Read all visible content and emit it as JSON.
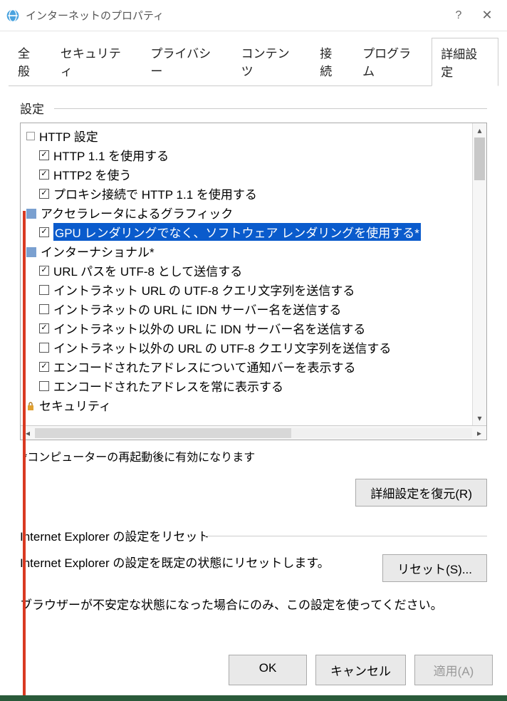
{
  "title": "インターネットのプロパティ",
  "tabs": [
    "全般",
    "セキュリティ",
    "プライバシー",
    "コンテンツ",
    "接続",
    "プログラム",
    "詳細設定"
  ],
  "activeTab": 6,
  "settings_label": "設定",
  "tree": [
    {
      "type": "cat",
      "icon": "doc",
      "label": "HTTP 設定"
    },
    {
      "type": "item",
      "checked": true,
      "label": "HTTP 1.1 を使用する"
    },
    {
      "type": "item",
      "checked": true,
      "label": "HTTP2 を使う"
    },
    {
      "type": "item",
      "checked": true,
      "label": "プロキシ接続で HTTP 1.1 を使用する"
    },
    {
      "type": "cat",
      "icon": "accel",
      "label": "アクセラレータによるグラフィック"
    },
    {
      "type": "item",
      "checked": true,
      "selected": true,
      "label": "GPU レンダリングでなく、ソフトウェア レンダリングを使用する*"
    },
    {
      "type": "cat",
      "icon": "intl",
      "label": "インターナショナル*"
    },
    {
      "type": "item",
      "checked": true,
      "label": "URL パスを UTF-8 として送信する"
    },
    {
      "type": "item",
      "checked": false,
      "label": "イントラネット URL の UTF-8 クエリ文字列を送信する"
    },
    {
      "type": "item",
      "checked": false,
      "label": "イントラネットの URL に IDN サーバー名を送信する"
    },
    {
      "type": "item",
      "checked": true,
      "label": "イントラネット以外の URL に IDN サーバー名を送信する"
    },
    {
      "type": "item",
      "checked": false,
      "label": "イントラネット以外の URL の UTF-8 クエリ文字列を送信する"
    },
    {
      "type": "item",
      "checked": true,
      "label": "エンコードされたアドレスについて通知バーを表示する"
    },
    {
      "type": "item",
      "checked": false,
      "label": "エンコードされたアドレスを常に表示する"
    },
    {
      "type": "cat",
      "icon": "lock",
      "label": "セキュリティ"
    }
  ],
  "note": "*コンピューターの再起動後に有効になります",
  "restore_btn": "詳細設定を復元(R)",
  "reset_title": "Internet Explorer の設定をリセット",
  "reset_text": "Internet Explorer の設定を既定の状態にリセットします。",
  "reset_btn": "リセット(S)...",
  "reset_tip": "ブラウザーが不安定な状態になった場合にのみ、この設定を使ってください。",
  "ok": "OK",
  "cancel": "キャンセル",
  "apply": "適用(A)"
}
